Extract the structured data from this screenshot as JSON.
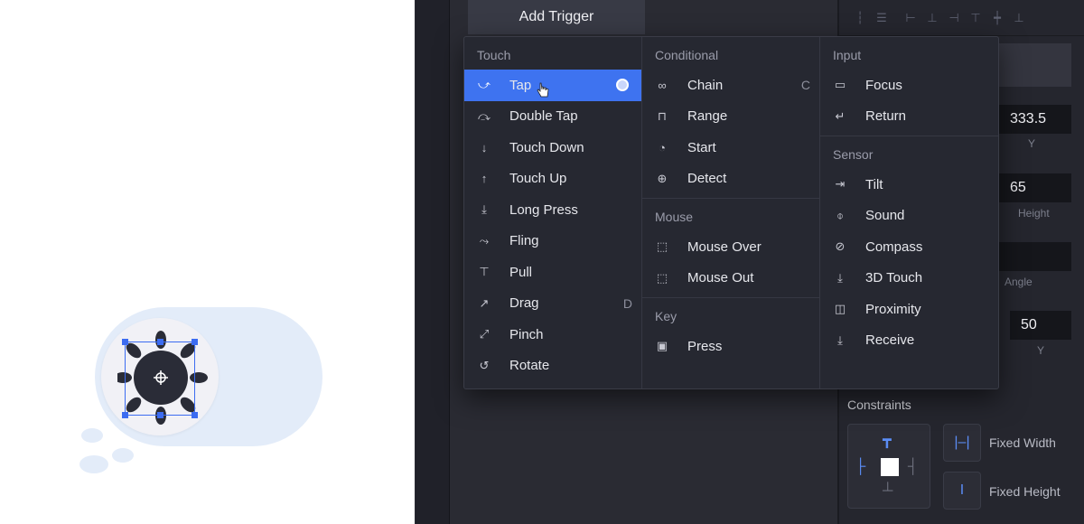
{
  "toolbar": {
    "add_trigger_label": "Add Trigger"
  },
  "menu": {
    "columns": [
      {
        "sections": [
          {
            "title": "Touch",
            "items": [
              {
                "label": "Tap",
                "icon": "tap-gesture-icon",
                "active": true
              },
              {
                "label": "Double Tap",
                "icon": "double-tap-icon"
              },
              {
                "label": "Touch Down",
                "icon": "touch-down-icon"
              },
              {
                "label": "Touch Up",
                "icon": "touch-up-icon"
              },
              {
                "label": "Long Press",
                "icon": "long-press-icon"
              },
              {
                "label": "Fling",
                "icon": "fling-icon"
              },
              {
                "label": "Pull",
                "icon": "pull-icon"
              },
              {
                "label": "Drag",
                "icon": "drag-icon",
                "shortcut": "D"
              },
              {
                "label": "Pinch",
                "icon": "pinch-icon"
              },
              {
                "label": "Rotate",
                "icon": "rotate-icon"
              }
            ]
          }
        ]
      },
      {
        "sections": [
          {
            "title": "Conditional",
            "items": [
              {
                "label": "Chain",
                "icon": "chain-link-icon",
                "shortcut": "C"
              },
              {
                "label": "Range",
                "icon": "range-icon"
              },
              {
                "label": "Start",
                "icon": "start-power-icon"
              },
              {
                "label": "Detect",
                "icon": "detect-crosshair-icon"
              }
            ]
          },
          {
            "title": "Mouse",
            "items": [
              {
                "label": "Mouse Over",
                "icon": "mouse-over-icon"
              },
              {
                "label": "Mouse Out",
                "icon": "mouse-out-icon"
              }
            ]
          },
          {
            "title": "Key",
            "items": [
              {
                "label": "Press",
                "icon": "key-press-icon"
              }
            ]
          }
        ]
      },
      {
        "sections": [
          {
            "title": "Input",
            "items": [
              {
                "label": "Focus",
                "icon": "focus-icon"
              },
              {
                "label": "Return",
                "icon": "return-key-icon"
              }
            ]
          },
          {
            "title": "Sensor",
            "items": [
              {
                "label": "Tilt",
                "icon": "tilt-icon"
              },
              {
                "label": "Sound",
                "icon": "microphone-icon"
              },
              {
                "label": "Compass",
                "icon": "compass-icon"
              },
              {
                "label": "3D Touch",
                "icon": "3d-touch-icon"
              },
              {
                "label": "Proximity",
                "icon": "proximity-icon"
              },
              {
                "label": "Receive",
                "icon": "receive-icon"
              }
            ]
          }
        ]
      }
    ]
  },
  "properties": {
    "y_value": "333.5",
    "y_label": "Y",
    "height_value": "65",
    "height_label": "Height",
    "angle_label": "Angle",
    "y2_value": "50",
    "y2_label": "Y"
  },
  "constraints": {
    "title": "Constraints",
    "fixed_width_label": "Fixed Width",
    "fixed_height_label": "Fixed Height"
  },
  "colors": {
    "accent": "#3e73f0",
    "menu_bg": "#262831",
    "canvas_bg": "#ffffff"
  }
}
